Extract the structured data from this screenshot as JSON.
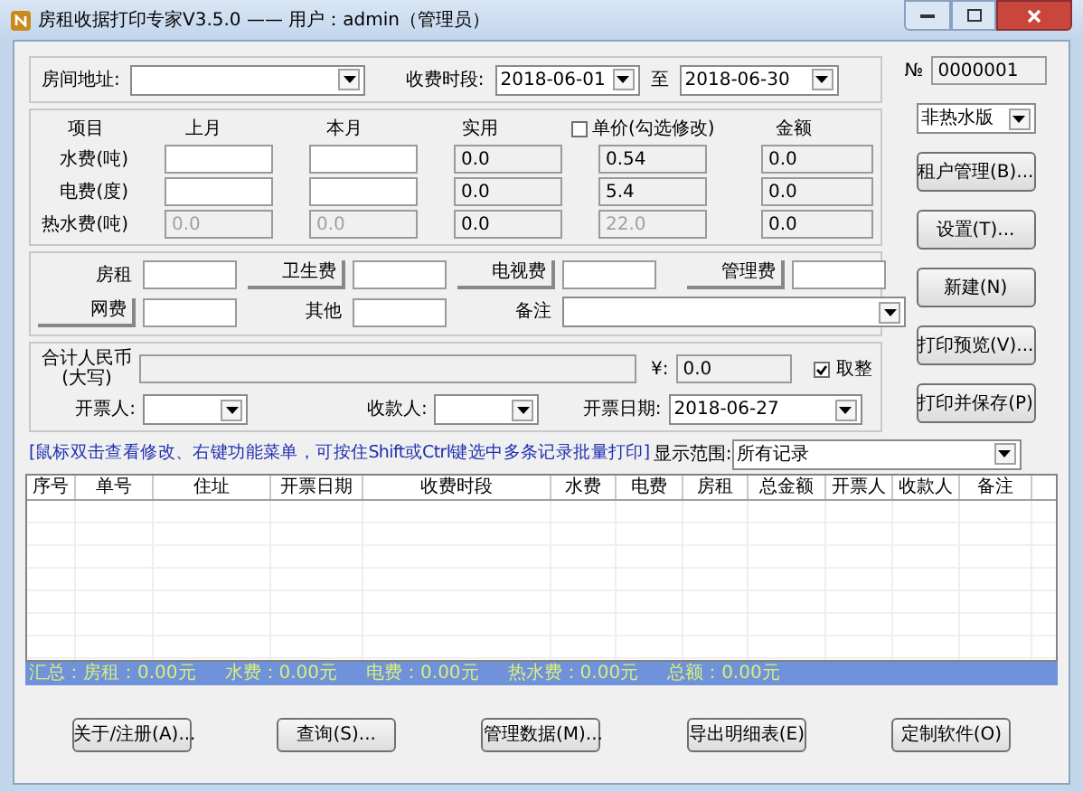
{
  "window": {
    "title": "房租收据打印专家V3.5.0 —— 用户：admin（管理员）"
  },
  "address": {
    "label": "房间地址:"
  },
  "period": {
    "label": "收费时段:",
    "from": "2018-06-01",
    "to_label": "至",
    "to": "2018-06-30"
  },
  "meter_table": {
    "columns": [
      "项目",
      "上月",
      "本月",
      "实用",
      "单价(勾选修改)",
      "金额"
    ],
    "unit_price_editable": false,
    "rows": [
      {
        "label": "水费(吨)",
        "disabled": false,
        "used": "0.0",
        "unit_price": "0.54",
        "amount": "0.0"
      },
      {
        "label": "电费(度)",
        "disabled": false,
        "used": "0.0",
        "unit_price": "5.4",
        "amount": "0.0"
      },
      {
        "label": "热水费(吨)",
        "disabled": true,
        "previous": "0.0",
        "current": "0.0",
        "used": "0.0",
        "unit_price": "22.0",
        "amount": "0.0"
      }
    ]
  },
  "fees": [
    {
      "label": "房租",
      "kind": "text"
    },
    {
      "label": "卫生费",
      "kind": "button"
    },
    {
      "label": "电视费",
      "kind": "button"
    },
    {
      "label": "管理费",
      "kind": "button"
    },
    {
      "label": "网费",
      "kind": "button"
    },
    {
      "label": "其他",
      "kind": "text"
    },
    {
      "label": "备注",
      "kind": "combo"
    }
  ],
  "total": {
    "label": "合计人民币\n(大写)",
    "currency_label": "¥:",
    "amount": "0.0",
    "round_label": "取整",
    "round_checked": true
  },
  "issuer": {
    "label": "开票人:"
  },
  "payee": {
    "label": "收款人:"
  },
  "issue_date": {
    "label": "开票日期:",
    "value": "2018-06-27"
  },
  "hint": "[鼠标双击查看修改、右键功能菜单，可按住Shift或Ctrl键选中多条记录批量打印]",
  "display_range": {
    "label": "显示范围:",
    "value": "所有记录"
  },
  "table": {
    "columns": [
      {
        "label": "序号"
      },
      {
        "label": "单号"
      },
      {
        "label": "住址"
      },
      {
        "label": "开票日期"
      },
      {
        "label": "收费时段"
      },
      {
        "label": "水费"
      },
      {
        "label": "电费"
      },
      {
        "label": "房租"
      },
      {
        "label": "总金额"
      },
      {
        "label": "开票人"
      },
      {
        "label": "收款人"
      },
      {
        "label": "备注"
      }
    ]
  },
  "summary": [
    "汇总：房租：0.00元",
    "水费：0.00元",
    "电费：0.00元",
    "热水费：0.00元",
    "总额：0.00元"
  ],
  "number": {
    "label": "№",
    "value": "0000001"
  },
  "water_mode": "非热水版",
  "side_buttons": [
    "租户管理(B)...",
    "设置(T)...",
    "新建(N)",
    "打印预览(V)...",
    "打印并保存(P)"
  ],
  "bottom_buttons": [
    "关于/注册(A)...",
    "查询(S)...",
    "管理数据(M)...",
    "导出明细表(E)",
    "定制软件(O)"
  ]
}
